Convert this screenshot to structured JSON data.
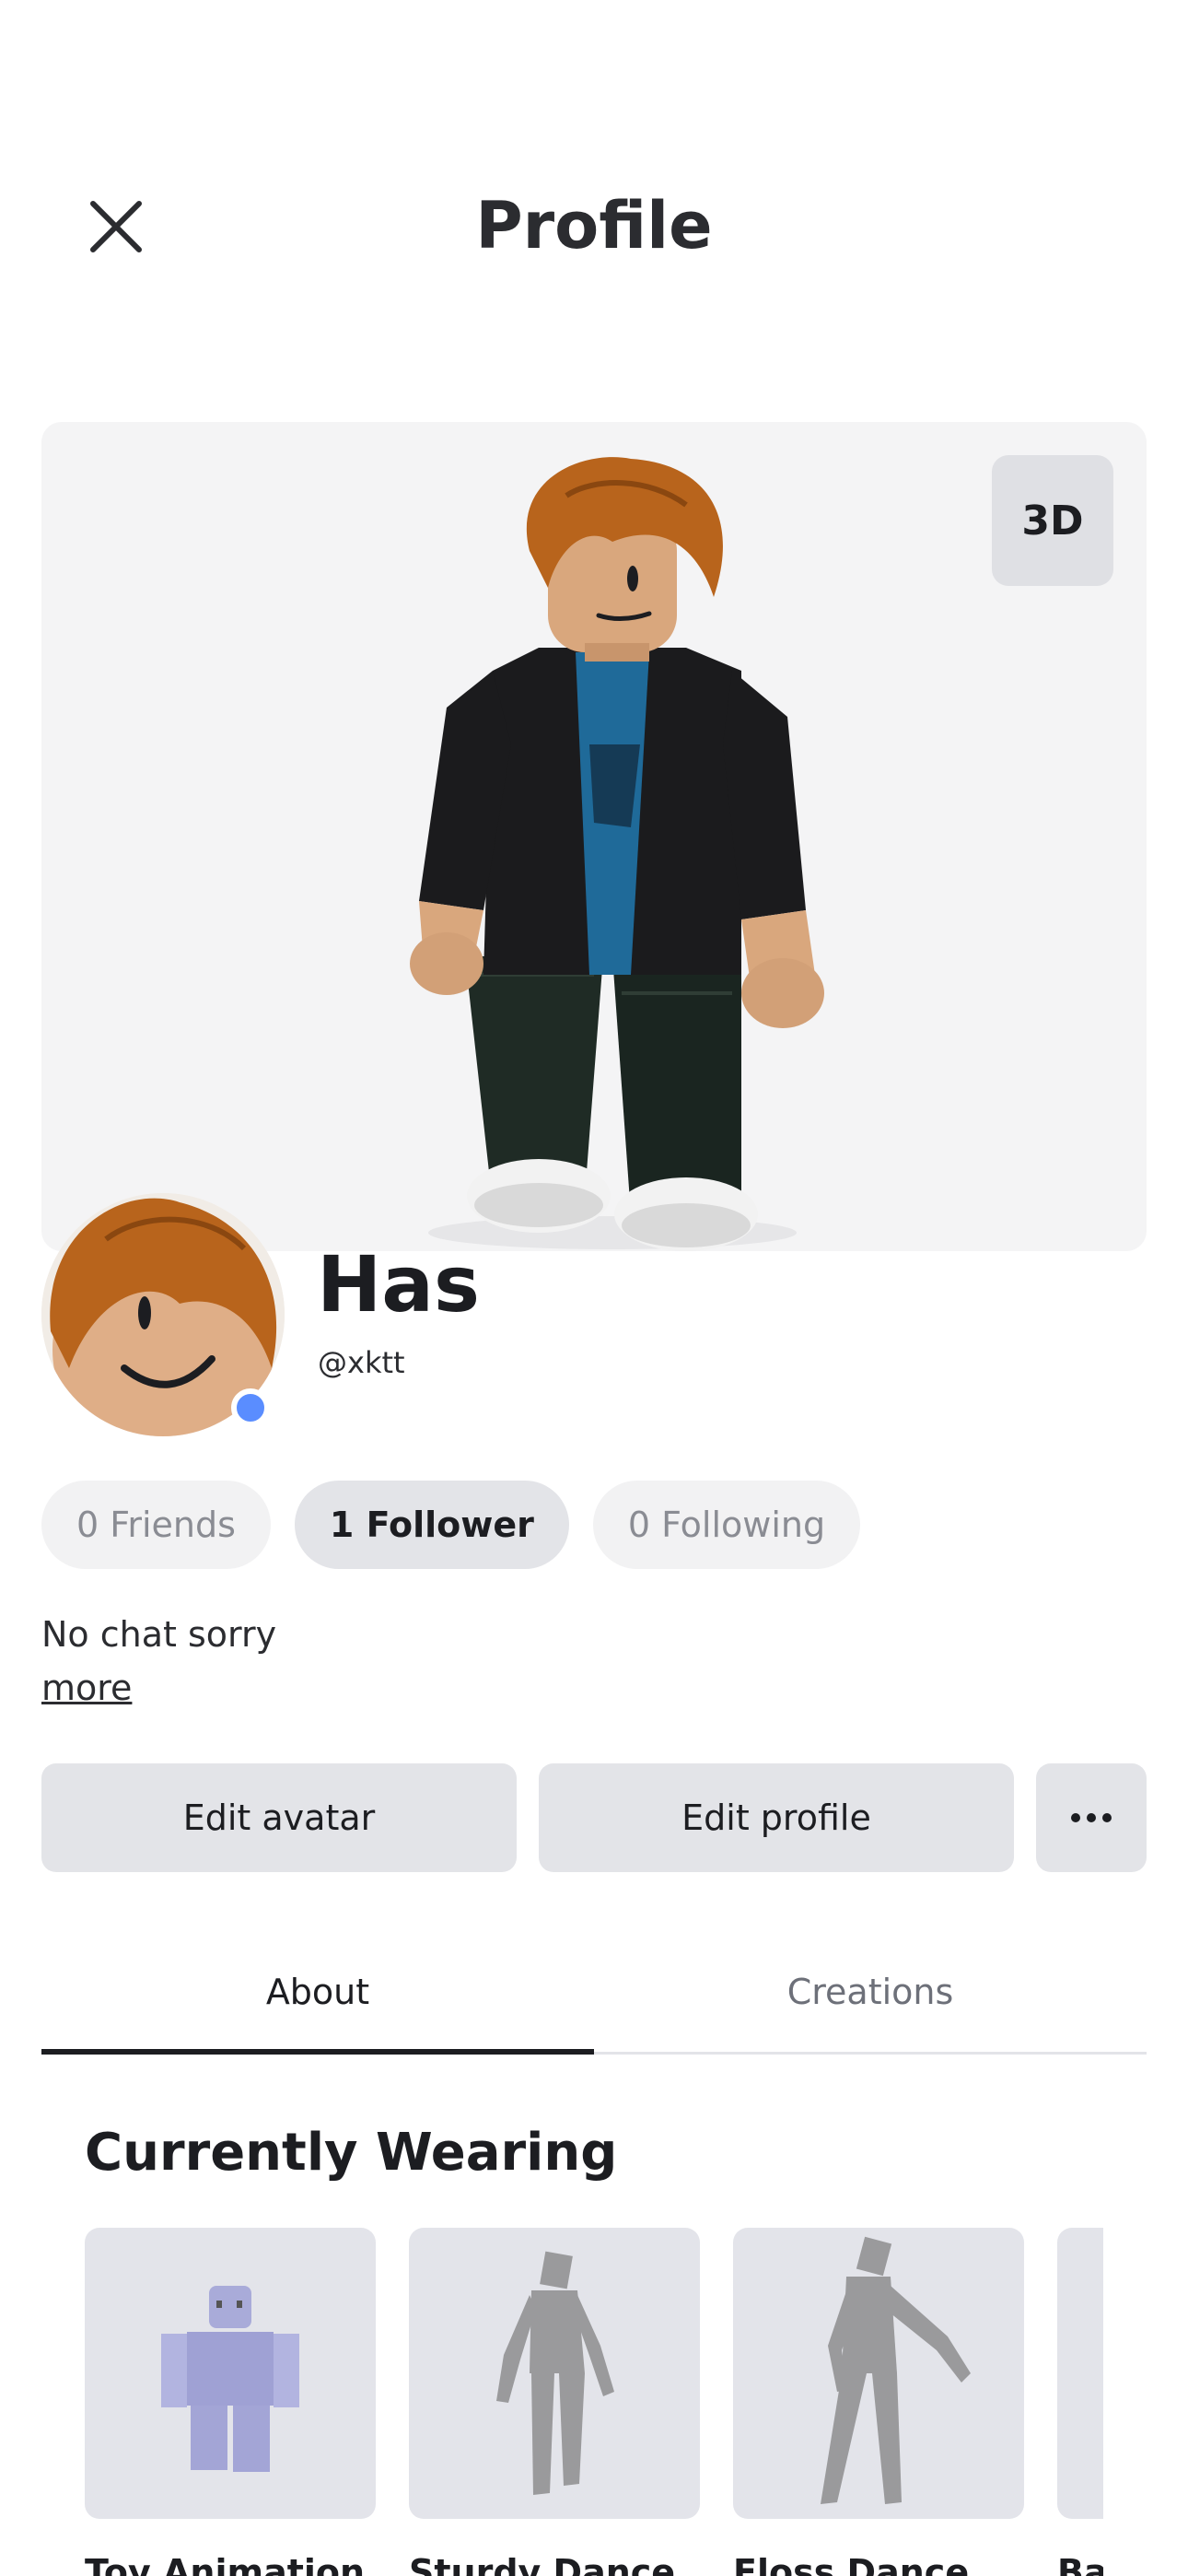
{
  "header": {
    "title": "Profile",
    "close_icon": "close-icon"
  },
  "avatar": {
    "view_toggle_label": "3D"
  },
  "profile": {
    "display_name": "Has",
    "username": "@xktt",
    "presence_color": "#5a8dff"
  },
  "stats": [
    {
      "label": "0 Friends"
    },
    {
      "label": "1 Follower"
    },
    {
      "label": "0 Following"
    }
  ],
  "bio": {
    "text": "No chat sorry",
    "more_label": "more"
  },
  "actions": {
    "edit_avatar": "Edit avatar",
    "edit_profile": "Edit profile",
    "more_icon": "more-horizontal-icon"
  },
  "tabs": [
    {
      "label": "About",
      "active": true
    },
    {
      "label": "Creations",
      "active": false
    }
  ],
  "currently_wearing": {
    "title": "Currently Wearing",
    "items": [
      {
        "name": "Toy Animation"
      },
      {
        "name": "Sturdy Dance"
      },
      {
        "name": "Floss Dance"
      },
      {
        "name": "Ba"
      }
    ]
  }
}
